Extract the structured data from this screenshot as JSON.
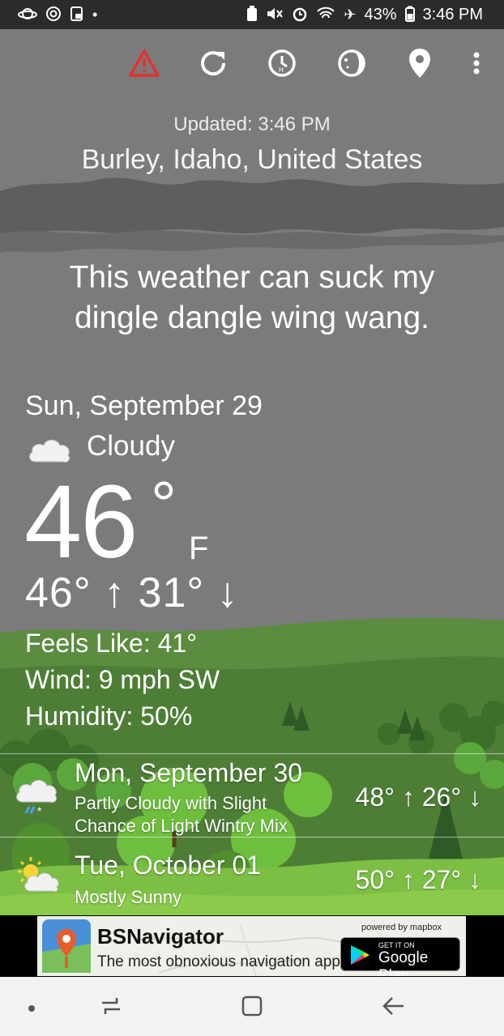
{
  "status_bar": {
    "battery": "43%",
    "time": "3:46 PM"
  },
  "toolbar": {
    "icons": [
      "alert-icon",
      "refresh-icon",
      "history-icon",
      "moon-phase-icon",
      "location-pin-icon",
      "more-options-icon"
    ]
  },
  "header": {
    "updated": "Updated: 3:46 PM",
    "location": "Burley, Idaho, United States"
  },
  "quote": "This weather can suck my dingle dangle wing wang.",
  "current": {
    "date": "Sun, September 29",
    "condition": "Cloudy",
    "temperature": "46",
    "degree_symbol": "°",
    "unit": "F",
    "hi_lo": "46° ↑ 31° ↓",
    "feels_like": "Feels Like: 41°",
    "wind": "Wind: 9 mph SW",
    "humidity": "Humidity: 50%"
  },
  "forecast": [
    {
      "date": "Mon, September 30",
      "desc_line1": "Partly Cloudy with Slight",
      "desc_line2": "Chance of Light Wintry Mix",
      "hi_lo": "48° ↑ 26° ↓",
      "icon": "cloud-wintry-mix-icon"
    },
    {
      "date": "Tue, October 01",
      "desc_line1": "Mostly Sunny",
      "hi_lo": "50° ↑ 27° ↓",
      "icon": "sun-cloud-icon"
    }
  ],
  "ad": {
    "title": "BSNavigator",
    "tagline": "The most obnoxious navigation app.",
    "powered_by": "powered by mapbox",
    "store_small": "GET IT ON",
    "store_big": "Google Play"
  },
  "colors": {
    "sky": "#7b7b7b",
    "alert": "#e53030",
    "grass": "#5e9a3a"
  }
}
